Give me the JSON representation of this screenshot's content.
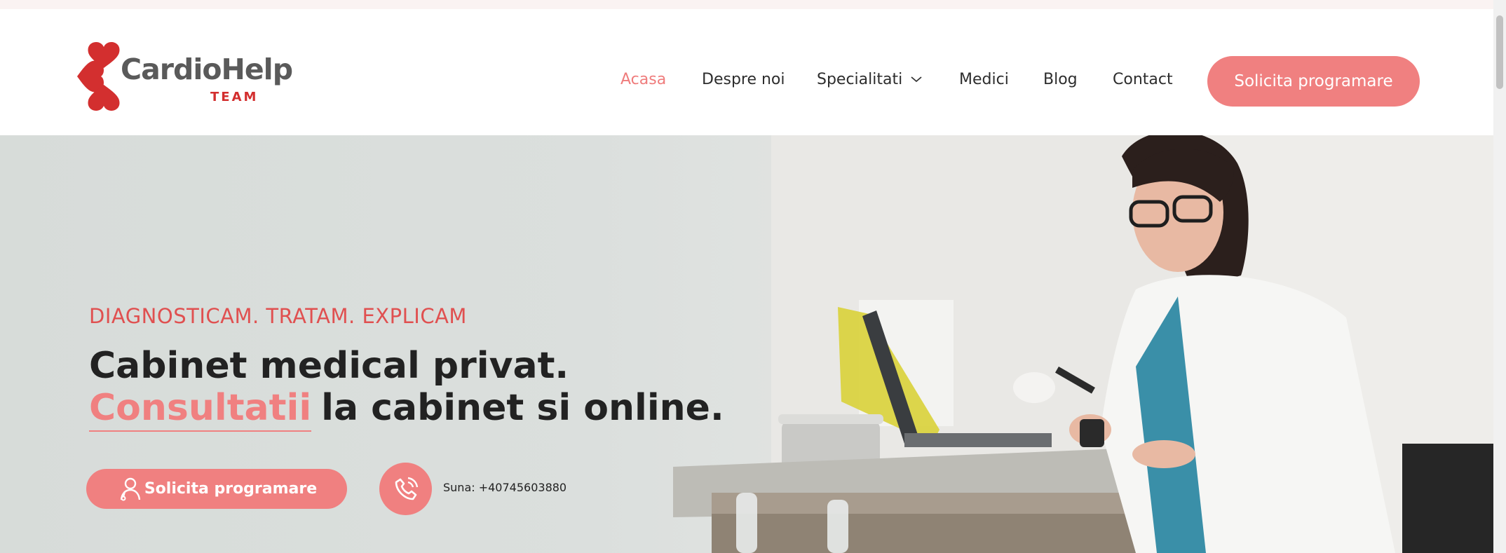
{
  "brand": {
    "name": "CardioHelp",
    "tagline": "TEAM",
    "colors": {
      "accent": "#f08080",
      "accent_dark": "#d32f2f",
      "text": "#222222"
    }
  },
  "nav": {
    "items": [
      {
        "label": "Acasa",
        "active": true
      },
      {
        "label": "Despre noi",
        "active": false
      },
      {
        "label": "Specialitati",
        "active": false,
        "has_dropdown": true
      },
      {
        "label": "Medici",
        "active": false
      },
      {
        "label": "Blog",
        "active": false
      },
      {
        "label": "Contact",
        "active": false
      }
    ],
    "cta_label": "Solicita programare"
  },
  "hero": {
    "eyebrow": "DIAGNOSTICAM. TRATAM. EXPLICAM",
    "title_line1": "Cabinet medical privat.",
    "title_line2_accent": "Consultatii",
    "title_line2_rest": "la cabinet si online.",
    "cta_label": "Solicita programare",
    "cta_icon": "doctor-icon",
    "phone_icon": "phone-icon",
    "phone_text": "Suna: +40745603880"
  }
}
